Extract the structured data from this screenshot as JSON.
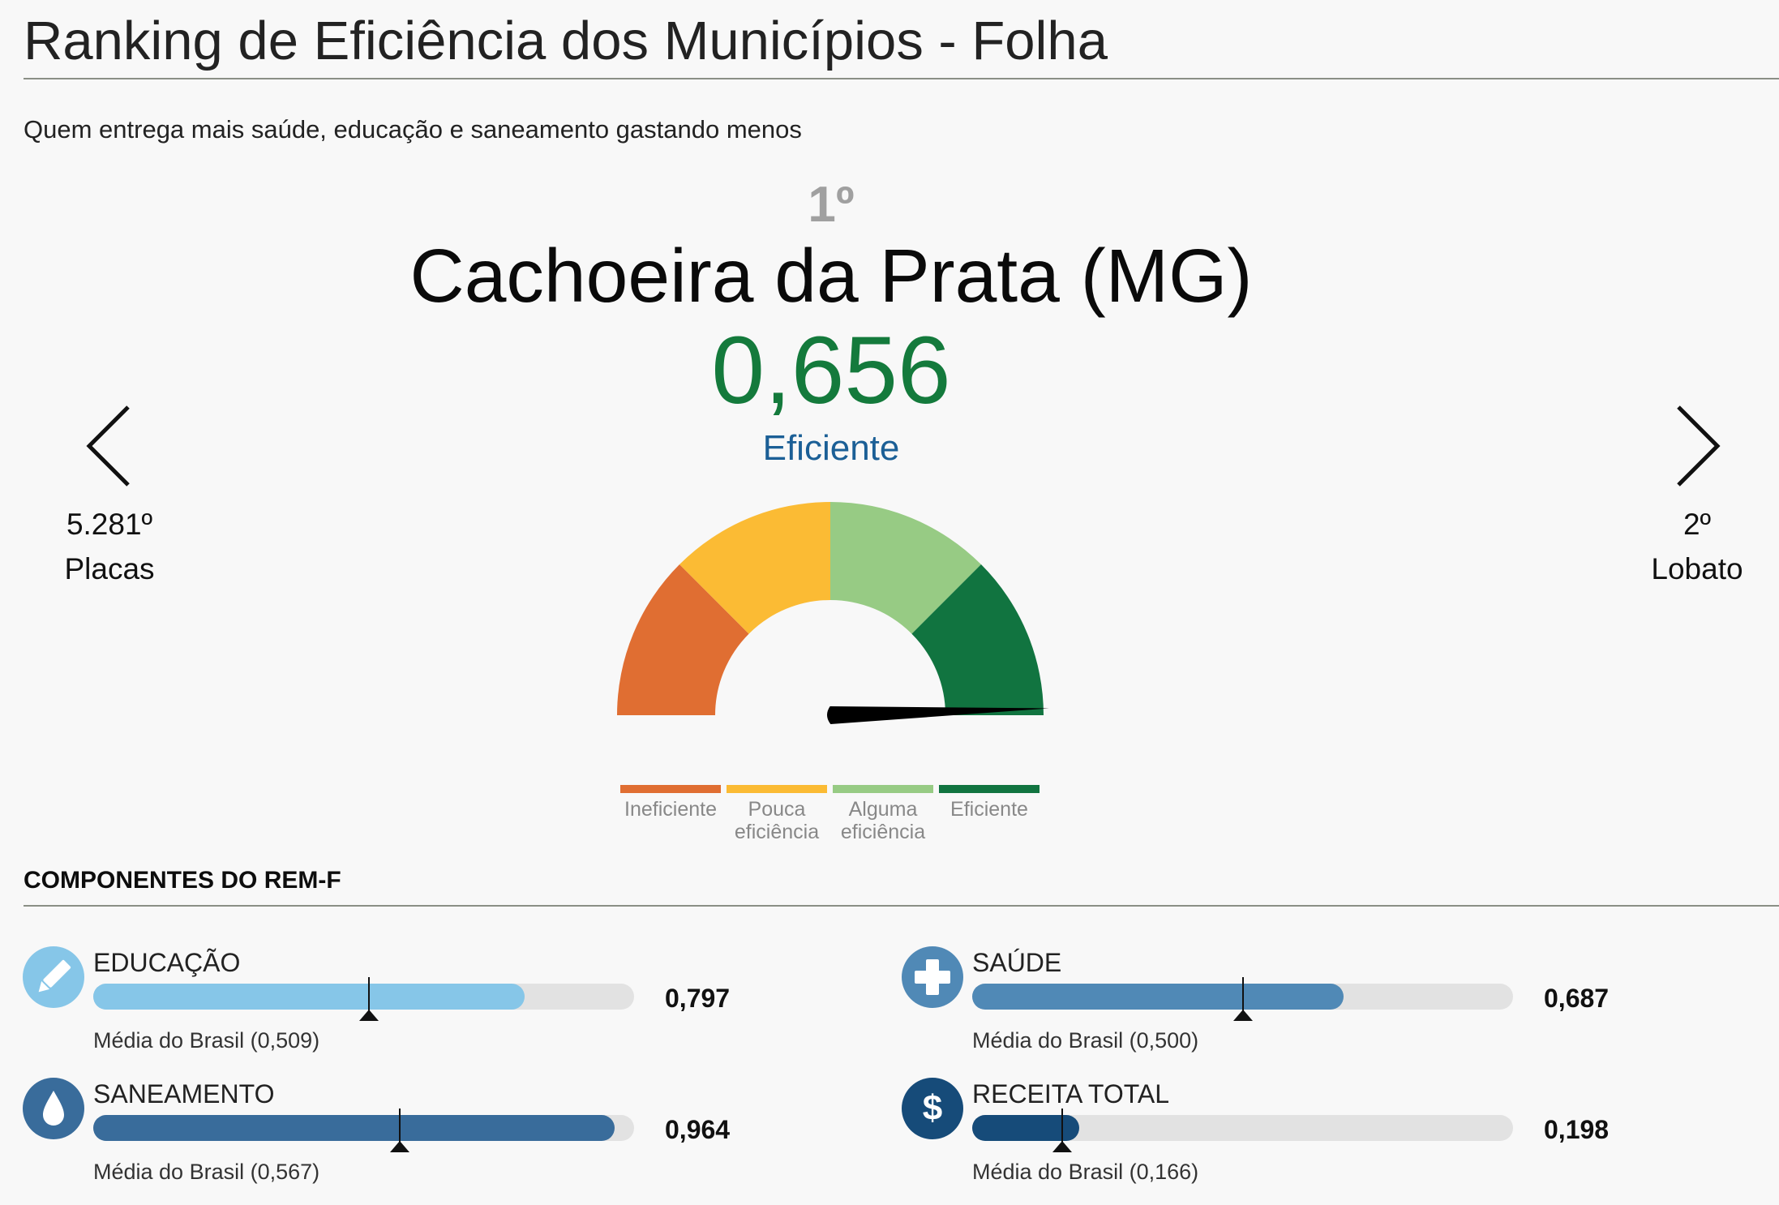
{
  "header": {
    "title": "Ranking de Eficiência dos Municípios - Folha",
    "subtitle": "Quem entrega mais saúde, educação e saneamento gastando menos"
  },
  "featured": {
    "rank": "1º",
    "city": "Cachoeira da Prata (MG)",
    "score": "0,656",
    "score_value": 0.656,
    "category": "Eficiente"
  },
  "nav": {
    "prev": {
      "rank": "5.281º",
      "city": "Placas"
    },
    "next": {
      "rank": "2º",
      "city": "Lobato"
    }
  },
  "gauge": {
    "min": 0,
    "max": 1,
    "value": 0.656,
    "needle_fraction": 0.99,
    "segments": [
      {
        "label": "Ineficiente",
        "color": "#e06e32"
      },
      {
        "label": "Pouca eficiência",
        "color": "#fbbb34"
      },
      {
        "label": "Alguma eficiência",
        "color": "#97cb84"
      },
      {
        "label": "Eficiente",
        "color": "#117440"
      }
    ]
  },
  "legend": [
    {
      "label_line1": "Ineficiente",
      "label_line2": "",
      "color": "#e06e32"
    },
    {
      "label_line1": "Pouca",
      "label_line2": "eficiência",
      "color": "#fbbb34"
    },
    {
      "label_line1": "Alguma",
      "label_line2": "eficiência",
      "color": "#97cb84"
    },
    {
      "label_line1": "Eficiente",
      "label_line2": "",
      "color": "#117440"
    }
  ],
  "components": {
    "title": "COMPONENTES DO REM-F",
    "items": [
      {
        "key": "educacao",
        "name": "EDUCAÇÃO",
        "value": 0.797,
        "value_text": "0,797",
        "avg": 0.509,
        "avg_text": "Média do Brasil (0,509)",
        "color": "#86c6e8",
        "icon": "pencil-icon"
      },
      {
        "key": "saude",
        "name": "SAÚDE",
        "value": 0.687,
        "value_text": "0,687",
        "avg": 0.5,
        "avg_text": "Média do Brasil (0,500)",
        "color": "#5089b6",
        "icon": "plus-icon"
      },
      {
        "key": "saneamento",
        "name": "SANEAMENTO",
        "value": 0.964,
        "value_text": "0,964",
        "avg": 0.567,
        "avg_text": "Média do Brasil (0,567)",
        "color": "#396c9b",
        "icon": "drop-icon"
      },
      {
        "key": "receita",
        "name": "RECEITA TOTAL",
        "value": 0.198,
        "value_text": "0,198",
        "avg": 0.166,
        "avg_text": "Média do Brasil (0,166)",
        "color": "#164b79",
        "icon": "dollar-icon"
      }
    ]
  }
}
